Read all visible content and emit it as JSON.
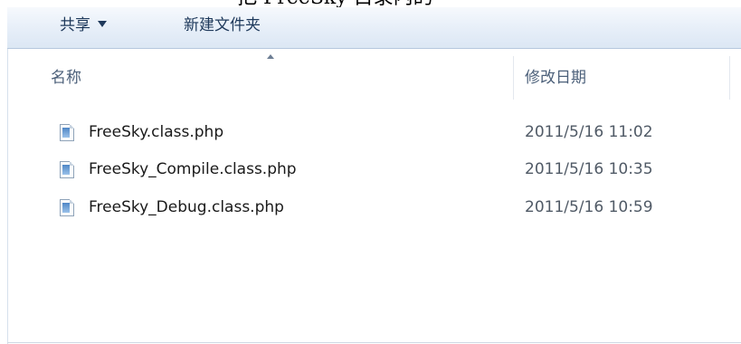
{
  "caption": {
    "text": "把 FreeSky 目录内的"
  },
  "toolbar": {
    "share_label": "共享",
    "new_folder_label": "新建文件夹"
  },
  "columns": {
    "name": "名称",
    "date_modified": "修改日期"
  },
  "files": [
    {
      "name": "FreeSky.class.php",
      "date": "2011/5/16 11:02",
      "icon": "php-file-icon"
    },
    {
      "name": "FreeSky_Compile.class.php",
      "date": "2011/5/16 10:35",
      "icon": "php-file-icon"
    },
    {
      "name": "FreeSky_Debug.class.php",
      "date": "2011/5/16 10:59",
      "icon": "php-file-icon"
    }
  ],
  "colors": {
    "toolbar_text": "#1e395b",
    "header_text": "#4c607a",
    "date_text": "#505a66"
  }
}
